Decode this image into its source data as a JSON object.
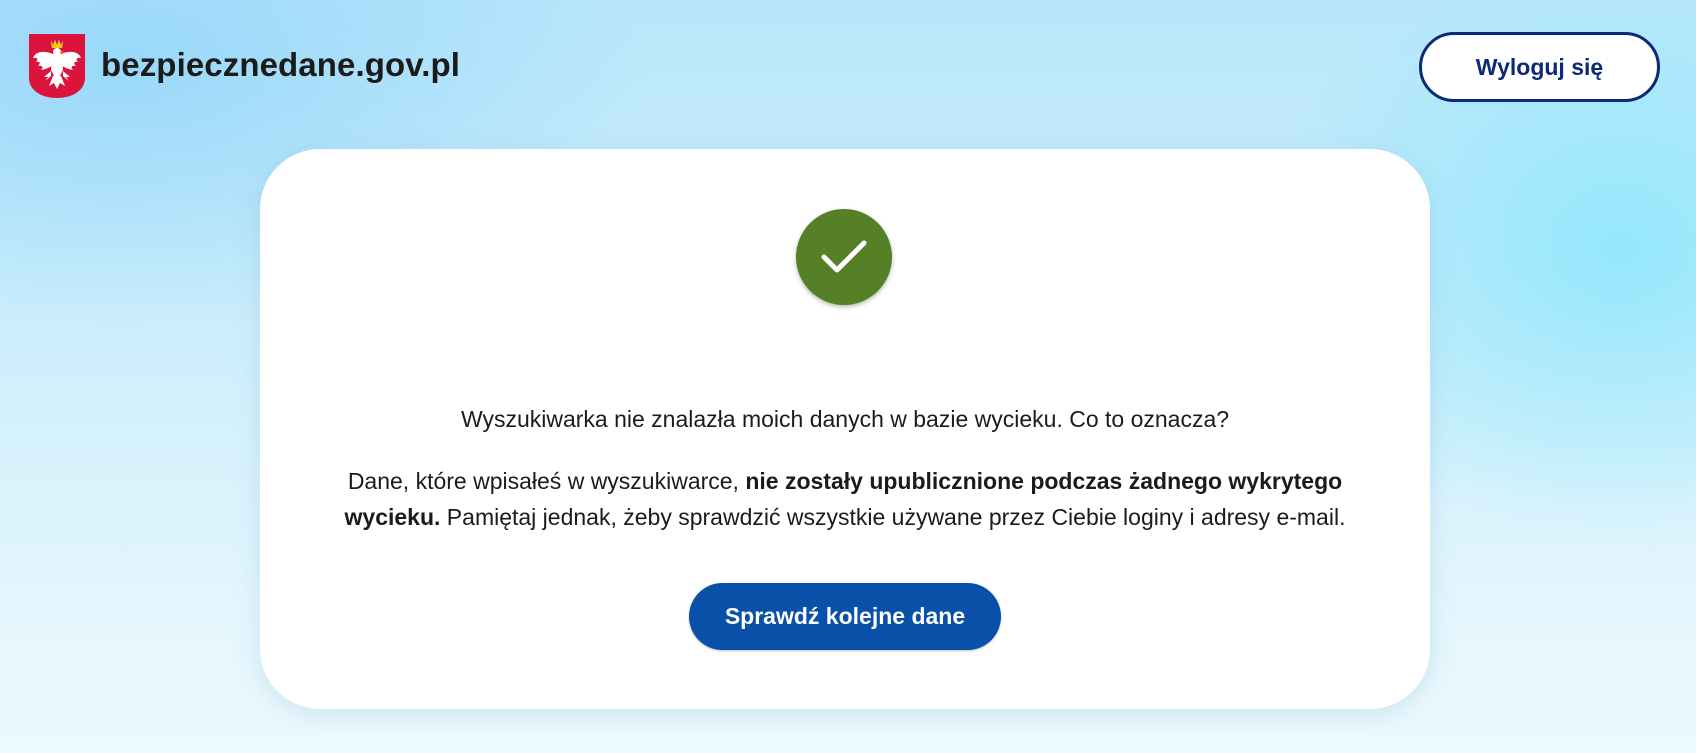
{
  "header": {
    "site_name": "bezpiecznedane.gov.pl",
    "logo_icon": "polish-eagle-emblem-icon",
    "logout_label": "Wyloguj się"
  },
  "result": {
    "status_icon": "checkmark-icon",
    "status_color": "#568025",
    "question": "Wyszukiwarka nie znalazła moich danych w bazie wycieku. Co to oznacza?",
    "description_before": "Dane, które wpisałeś w wyszukiwarce, ",
    "description_bold": "nie zostały upublicznione podczas żadnego wykrytego wycieku.",
    "description_after": " Pamiętaj jednak, żeby sprawdzić wszystkie używane przez Ciebie loginy i adresy e-mail.",
    "check_again_label": "Sprawdź kolejne dane"
  },
  "colors": {
    "primary": "#0850a8",
    "outline": "#0b2a78",
    "emblem_red": "#dc143c"
  }
}
